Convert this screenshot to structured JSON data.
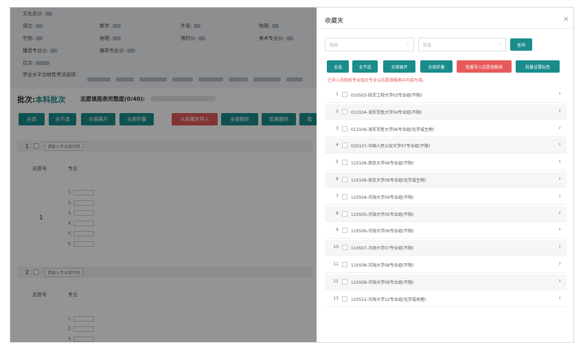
{
  "info": {
    "line1": "文化总分:",
    "line2": [
      "语文:",
      "数学:",
      "外语:",
      "物理:"
    ],
    "line3": [
      "生物:",
      "地理:",
      "限时分:",
      "美术专业分:"
    ],
    "line4": [
      "播音专业分:",
      "编导专业分:"
    ],
    "line5": "位次:",
    "line6": "学业水平合格性考试成绩:"
  },
  "batch": {
    "prefix": "批次:",
    "name": "本科批次",
    "progress_label": "志愿填报表完整度(0/40):",
    "progress_fraction": 0
  },
  "toolbar": {
    "select_all": "全选",
    "select_none": "全不选",
    "expand_all": "全部展开",
    "collapse_all": "全部折叠",
    "import_fav": "从收藏夹导入",
    "delete_all": "全部删除",
    "batch_delete": "批量删除",
    "batch_more": "批"
  },
  "groups": [
    {
      "num": "1",
      "input_hint": "请输入专业组代码",
      "col_wish": "志愿号",
      "col_major": "专业",
      "wish_no": "1",
      "majors": [
        "1.",
        "2.",
        "3.",
        "4.",
        "5.",
        "6."
      ]
    },
    {
      "num": "2",
      "input_hint": "请输入专业组代码",
      "col_wish": "志愿号",
      "col_major": "专业",
      "majors": [
        "1.",
        "2.",
        "3."
      ]
    }
  ],
  "modal": {
    "title": "收藏夹",
    "close": "×",
    "filter1_placeholder": "院校",
    "filter2_placeholder": "状态",
    "query": "查询",
    "buttons": {
      "select_all": "全选",
      "select_none": "全不选",
      "expand_all": "全部展开",
      "collapse_all": "全部折叠",
      "batch_import": "批量导入志愿填报表",
      "batch_tag": "批量设置标签"
    },
    "hint": "已导入的院校专业组在专业以志愿填报表中内容为准。",
    "items": [
      {
        "num": "1",
        "text": "010503-陆军工程大学03专业组(不限)"
      },
      {
        "num": "2",
        "text": "013104-海军军医大学04专业组(不限)"
      },
      {
        "num": "3",
        "text": "013106-海军军医大学06专业组(化学或生物)"
      },
      {
        "num": "4",
        "text": "020107-中国人民公安大学07专业组(不限)"
      },
      {
        "num": "5",
        "text": "110106-南京大学06专业组(不限)"
      },
      {
        "num": "6",
        "text": "110109-南京大学09专业组(化学或生物)"
      },
      {
        "num": "7",
        "text": "110504-河海大学04专业组(不限)"
      },
      {
        "num": "8",
        "text": "110505-河海大学05专业组(不限)"
      },
      {
        "num": "9",
        "text": "110506-河海大学06专业组(不限)"
      },
      {
        "num": "10",
        "text": "110507-河海大学07专业组(不限)"
      },
      {
        "num": "11",
        "text": "110508-河海大学08专业组(不限)"
      },
      {
        "num": "12",
        "text": "110509-河海大学09专业组(不限)"
      },
      {
        "num": "13",
        "text": "110512-河海大学12专业组(化学或地理)"
      }
    ]
  },
  "colors": {
    "primary": "#1a8c8c",
    "danger": "#e85a5a",
    "hint": "#e55353",
    "progress": "#5bc0de"
  }
}
